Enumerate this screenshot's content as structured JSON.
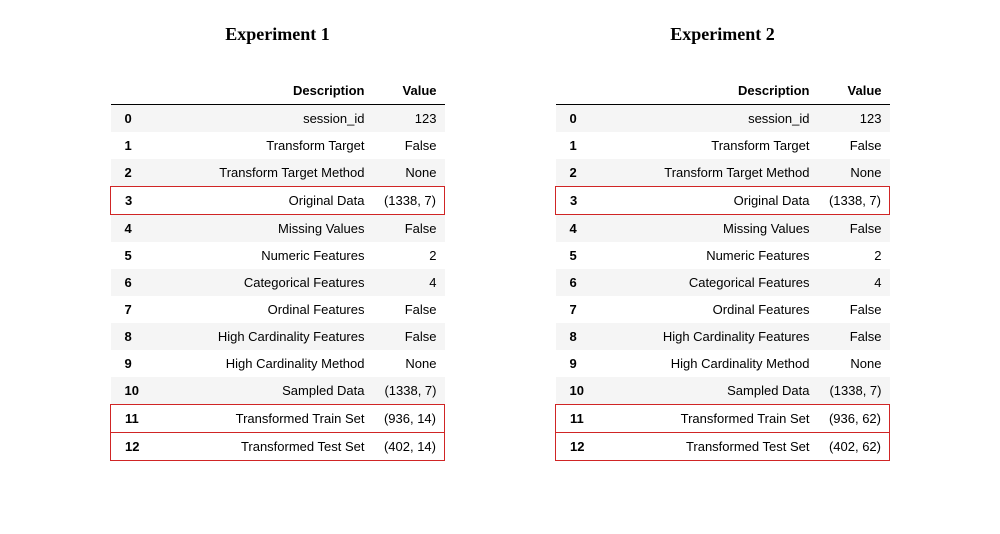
{
  "columns": {
    "index": "",
    "description": "Description",
    "value": "Value"
  },
  "experiments": [
    {
      "title": "Experiment 1",
      "rows": [
        {
          "index": "0",
          "description": "session_id",
          "value": "123",
          "highlight": false
        },
        {
          "index": "1",
          "description": "Transform Target",
          "value": "False",
          "highlight": false
        },
        {
          "index": "2",
          "description": "Transform Target Method",
          "value": "None",
          "highlight": false
        },
        {
          "index": "3",
          "description": "Original Data",
          "value": "(1338, 7)",
          "highlight": true
        },
        {
          "index": "4",
          "description": "Missing Values",
          "value": "False",
          "highlight": false
        },
        {
          "index": "5",
          "description": "Numeric Features",
          "value": "2",
          "highlight": false
        },
        {
          "index": "6",
          "description": "Categorical Features",
          "value": "4",
          "highlight": false
        },
        {
          "index": "7",
          "description": "Ordinal Features",
          "value": "False",
          "highlight": false
        },
        {
          "index": "8",
          "description": "High Cardinality Features",
          "value": "False",
          "highlight": false
        },
        {
          "index": "9",
          "description": "High Cardinality Method",
          "value": "None",
          "highlight": false
        },
        {
          "index": "10",
          "description": "Sampled Data",
          "value": "(1338, 7)",
          "highlight": false
        },
        {
          "index": "11",
          "description": "Transformed Train Set",
          "value": "(936, 14)",
          "highlight": true
        },
        {
          "index": "12",
          "description": "Transformed Test Set",
          "value": "(402, 14)",
          "highlight": true
        }
      ]
    },
    {
      "title": "Experiment 2",
      "rows": [
        {
          "index": "0",
          "description": "session_id",
          "value": "123",
          "highlight": false
        },
        {
          "index": "1",
          "description": "Transform Target",
          "value": "False",
          "highlight": false
        },
        {
          "index": "2",
          "description": "Transform Target Method",
          "value": "None",
          "highlight": false
        },
        {
          "index": "3",
          "description": "Original Data",
          "value": "(1338, 7)",
          "highlight": true
        },
        {
          "index": "4",
          "description": "Missing Values",
          "value": "False",
          "highlight": false
        },
        {
          "index": "5",
          "description": "Numeric Features",
          "value": "2",
          "highlight": false
        },
        {
          "index": "6",
          "description": "Categorical Features",
          "value": "4",
          "highlight": false
        },
        {
          "index": "7",
          "description": "Ordinal Features",
          "value": "False",
          "highlight": false
        },
        {
          "index": "8",
          "description": "High Cardinality Features",
          "value": "False",
          "highlight": false
        },
        {
          "index": "9",
          "description": "High Cardinality Method",
          "value": "None",
          "highlight": false
        },
        {
          "index": "10",
          "description": "Sampled Data",
          "value": "(1338, 7)",
          "highlight": false
        },
        {
          "index": "11",
          "description": "Transformed Train Set",
          "value": "(936, 62)",
          "highlight": true
        },
        {
          "index": "12",
          "description": "Transformed Test Set",
          "value": "(402, 62)",
          "highlight": true
        }
      ]
    }
  ]
}
